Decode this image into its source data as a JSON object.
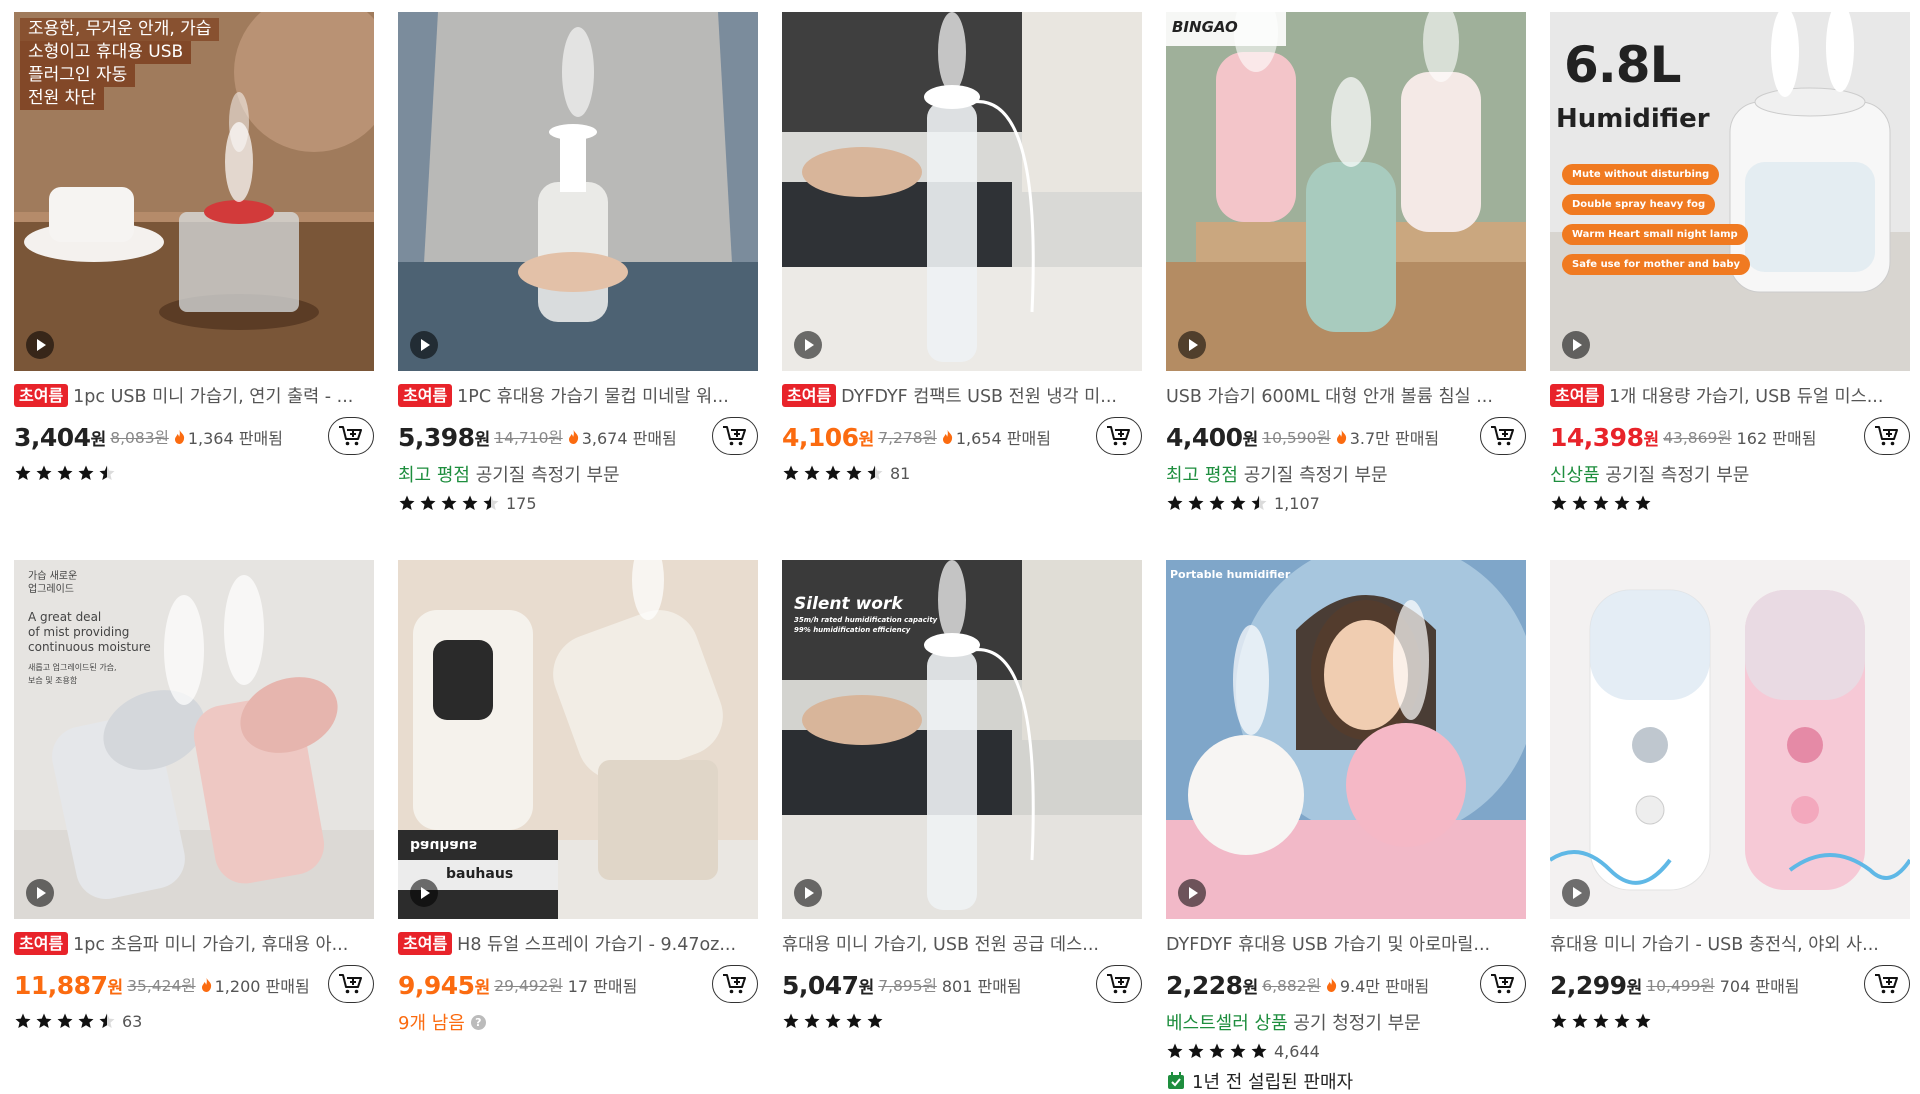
{
  "ui": {
    "video_icon": "play-icon",
    "cart_icon": "add-to-cart-icon",
    "flame_icon": "flame-icon",
    "star_icon": "star-icon",
    "seller_icon": "store-check-icon",
    "colors": {
      "badge": "#e8232a",
      "green": "#1e8e3e",
      "orange": "#fb6b10",
      "red_price": "#e8232a"
    }
  },
  "products": [
    {
      "badge": "초여름",
      "title": "1pc USB 미니 가습기, 연기 출력 - ...",
      "price": "3,404",
      "price_color": "dark",
      "currency": "원",
      "original_price": "8,083원",
      "sold_flame": true,
      "sold": "1,364 판매됨",
      "rating": 4.5,
      "rating_count": "",
      "image_text": [
        "조용한, 무거운 안개, 가습",
        "소형이고 휴대용 USB",
        "플러그인 자동",
        "전원 차단"
      ]
    },
    {
      "badge": "초여름",
      "title": "1PC 휴대용 가습기 물컵 미네랄 워...",
      "price": "5,398",
      "price_color": "dark",
      "currency": "원",
      "original_price": "14,710원",
      "sold_flame": true,
      "sold": "3,674 판매됨",
      "sub_highlight": "최고 평점",
      "sub_rest": " 공기질 측정기 부문",
      "rating": 4.5,
      "rating_count": "175"
    },
    {
      "badge": "초여름",
      "title": "DYFDYF 컴팩트 USB 전원 냉각 미...",
      "price": "4,106",
      "price_color": "orange",
      "currency": "원",
      "original_price": "7,278원",
      "sold_flame": true,
      "sold": "1,654 판매됨",
      "rating": 4.5,
      "rating_count": "81"
    },
    {
      "badge": "",
      "title": "USB 가습기 600ML 대형 안개 볼륨 침실 ...",
      "price": "4,400",
      "price_color": "dark",
      "currency": "원",
      "original_price": "10,590원",
      "sold_flame": true,
      "sold": "3.7만 판매됨",
      "sub_highlight": "최고 평점",
      "sub_rest": " 공기질 측정기 부문",
      "rating": 4.5,
      "rating_count": "1,107",
      "image_text": [
        "BINGAO"
      ]
    },
    {
      "badge": "초여름",
      "title": "1개 대용량 가습기, USB 듀얼 미스...",
      "price": "14,398",
      "price_color": "red",
      "currency": "원",
      "original_price": "43,869원",
      "sold_flame": false,
      "sold": "162 판매됨",
      "sub_highlight": "신상품",
      "sub_rest": " 공기질 측정기 부문",
      "rating": 5,
      "rating_count": "",
      "image_text": [
        "6.8L",
        "Humidifier",
        "Mute without disturbing",
        "Double spray heavy fog",
        "Warm Heart small night lamp",
        "Safe use for mother and baby"
      ]
    },
    {
      "badge": "초여름",
      "title": "1pc 초음파 미니 가습기, 휴대용 아...",
      "price": "11,887",
      "price_color": "orange",
      "currency": "원",
      "original_price": "35,424원",
      "sold_flame": true,
      "sold": "1,200 판매됨",
      "rating": 4.5,
      "rating_count": "63",
      "image_text": [
        "가습 새로운",
        "업그레이드",
        "A great deal",
        "of mist providing",
        "continuous moisture",
        "새롭고 업그레이드된 가습,",
        "보습 및 조용함"
      ]
    },
    {
      "badge": "초여름",
      "title": "H8 듀얼 스프레이 가습기 - 9.47oz...",
      "price": "9,945",
      "price_color": "orange",
      "currency": "원",
      "original_price": "29,492원",
      "sold_flame": false,
      "sold": "17 판매됨",
      "stock_text": "9개 남음",
      "rating": 0,
      "rating_count": "",
      "image_text": [
        "bauhaus",
        "bauhaus"
      ]
    },
    {
      "badge": "",
      "title": "휴대용 미니 가습기, USB 전원 공급 데스...",
      "price": "5,047",
      "price_color": "dark",
      "currency": "원",
      "original_price": "7,895원",
      "sold_flame": false,
      "sold": "801 판매됨",
      "rating": 5,
      "rating_count": "",
      "image_text": [
        "Silent work",
        "35m/h rated humidification capacity",
        "99% humidification efficiency"
      ]
    },
    {
      "badge": "",
      "title": "DYFDYF 휴대용 USB 가습기 및 아로마릴...",
      "price": "2,228",
      "price_color": "dark",
      "currency": "원",
      "original_price": "6,882원",
      "sold_flame": true,
      "sold": "9.4만 판매됨",
      "sub_highlight": "베스트셀러 상품",
      "sub_rest": " 공기 청정기 부문",
      "rating": 5,
      "rating_count": "4,644",
      "seller_text": "1년 전 설립된 판매자",
      "image_text": [
        "Portable humidifier"
      ]
    },
    {
      "badge": "",
      "title": "휴대용 미니 가습기 - USB 충전식, 야외 사...",
      "price": "2,299",
      "price_color": "dark",
      "currency": "원",
      "original_price": "10,499원",
      "sold_flame": false,
      "sold": "704 판매됨",
      "rating": 5,
      "rating_count": ""
    }
  ]
}
